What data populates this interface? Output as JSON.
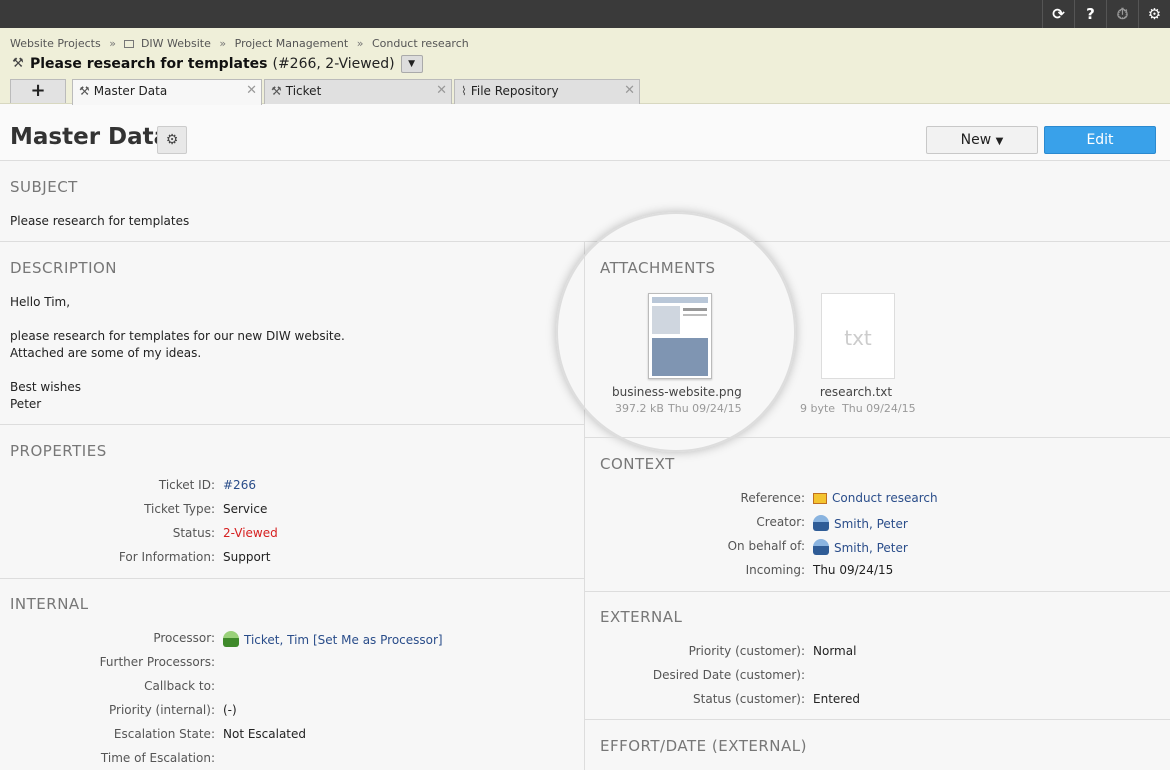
{
  "topbar": {
    "icons": [
      "refresh-icon",
      "help-icon",
      "timer-icon",
      "gear-icon"
    ],
    "help_label": "?"
  },
  "breadcrumb": {
    "items": [
      "Website Projects",
      "DIW Website",
      "Project Management",
      "Conduct research"
    ],
    "sep": "»"
  },
  "title": {
    "main": "Please research for templates",
    "meta": "(#266, 2-Viewed)"
  },
  "tabs": [
    {
      "label": "Master Data",
      "icon": "tool-icon"
    },
    {
      "label": "Ticket",
      "icon": "tool-icon"
    },
    {
      "label": "File Repository",
      "icon": "paperclip-icon"
    }
  ],
  "tab_add_label": "+",
  "page": {
    "title": "Master Data",
    "new_label": "New",
    "edit_label": "Edit"
  },
  "subject": {
    "title": "SUBJECT",
    "text": "Please research for templates"
  },
  "description": {
    "title": "DESCRIPTION",
    "lines": [
      "Hello Tim,",
      "please research for templates for our new DIW website.",
      "Attached are some of my ideas.",
      "Best wishes",
      "Peter"
    ]
  },
  "attachments": {
    "title": "ATTACHMENTS",
    "items": [
      {
        "name": "business-website.png",
        "size": "397.2 kB",
        "date": "Thu 09/24/15"
      },
      {
        "name": "research.txt",
        "size": "9 byte",
        "date": "Thu 09/24/15",
        "ext": "txt"
      }
    ]
  },
  "properties": {
    "title": "PROPERTIES",
    "rows": [
      {
        "key": "Ticket ID:",
        "value": "#266"
      },
      {
        "key": "Ticket Type:",
        "value": "Service"
      },
      {
        "key": "Status:",
        "value": "2-Viewed"
      },
      {
        "key": "For Information:",
        "value": "Support"
      }
    ]
  },
  "context": {
    "title": "CONTEXT",
    "rows": [
      {
        "key": "Reference:",
        "value": "Conduct research"
      },
      {
        "key": "Creator:",
        "value": "Smith, Peter"
      },
      {
        "key": "On behalf of:",
        "value": "Smith, Peter"
      },
      {
        "key": "Incoming:",
        "value": "Thu 09/24/15"
      }
    ]
  },
  "internal": {
    "title": "INTERNAL",
    "rows": [
      {
        "key": "Processor:",
        "value": "Ticket, Tim",
        "extra": "[Set Me as Processor]"
      },
      {
        "key": "Further Processors:",
        "value": ""
      },
      {
        "key": "Callback to:",
        "value": ""
      },
      {
        "key": "Priority (internal):",
        "value": "(-)"
      },
      {
        "key": "Escalation State:",
        "value": "Not Escalated"
      },
      {
        "key": "Time of Escalation:",
        "value": ""
      }
    ]
  },
  "external": {
    "title": "EXTERNAL",
    "rows": [
      {
        "key": "Priority (customer):",
        "value": "Normal"
      },
      {
        "key": "Desired Date (customer):",
        "value": ""
      },
      {
        "key": "Status (customer):",
        "value": "Entered"
      }
    ]
  },
  "effort": {
    "title": "EFFORT/DATE (EXTERNAL)"
  },
  "colors": {
    "accent": "#39a1ea",
    "status_red": "#d62020",
    "link": "#2a4d8a",
    "header_bg": "#efefd9"
  }
}
